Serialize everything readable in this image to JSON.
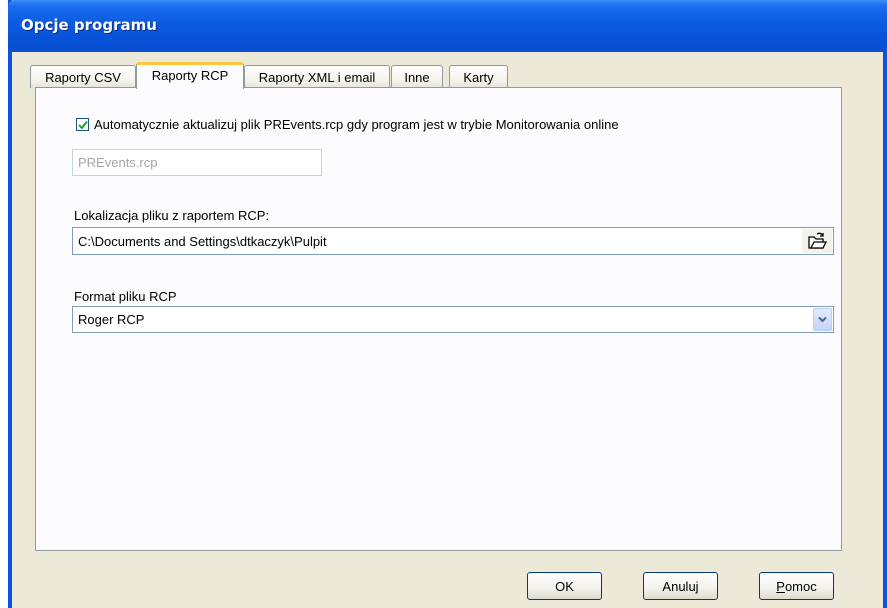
{
  "window": {
    "title": "Opcje programu"
  },
  "tabs": [
    {
      "label": "Raporty CSV",
      "active": false
    },
    {
      "label": "Raporty RCP",
      "active": true
    },
    {
      "label": "Raporty XML i email",
      "active": false
    },
    {
      "label": "Inne",
      "active": false
    },
    {
      "label": "Karty",
      "active": false
    }
  ],
  "rcp": {
    "auto_update_checked": true,
    "auto_update_label": "Automatycznie aktualizuj plik PREvents.rcp gdy program jest w trybie Monitorowania online",
    "filename_value": "PREvents.rcp",
    "location_label": "Lokalizacja pliku z raportem RCP:",
    "location_value": "C:\\Documents and Settings\\dtkaczyk\\Pulpit",
    "format_label": "Format pliku RCP",
    "format_value": "Roger RCP"
  },
  "buttons": {
    "ok": "OK",
    "cancel": "Anuluj",
    "help_first": "P",
    "help_rest": "omoc"
  },
  "icons": {
    "checkmark": "check-icon",
    "browse": "folder-open-icon",
    "dropdown": "chevron-down-icon"
  }
}
